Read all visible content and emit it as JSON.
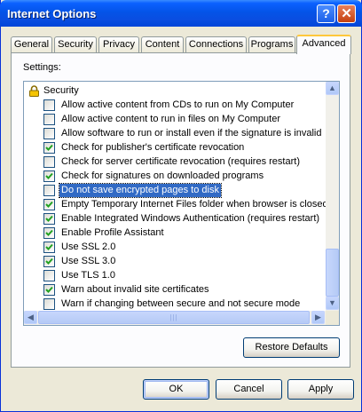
{
  "window": {
    "title": "Internet Options",
    "help_label": "?",
    "close_label": "✕"
  },
  "tabs": [
    "General",
    "Security",
    "Privacy",
    "Content",
    "Connections",
    "Programs",
    "Advanced"
  ],
  "active_tab": "Advanced",
  "settings_label": "Settings:",
  "settings": {
    "group": {
      "label": "Security",
      "icon": "lock-icon"
    },
    "items": [
      {
        "label": "Allow active content from CDs to run on My Computer",
        "checked": false
      },
      {
        "label": "Allow active content to run in files on My Computer",
        "checked": false
      },
      {
        "label": "Allow software to run or install even if the signature is invalid",
        "checked": false
      },
      {
        "label": "Check for publisher's certificate revocation",
        "checked": true
      },
      {
        "label": "Check for server certificate revocation (requires restart)",
        "checked": false
      },
      {
        "label": "Check for signatures on downloaded programs",
        "checked": true
      },
      {
        "label": "Do not save encrypted pages to disk",
        "checked": false,
        "selected": true
      },
      {
        "label": "Empty Temporary Internet Files folder when browser is closed",
        "checked": true
      },
      {
        "label": "Enable Integrated Windows Authentication (requires restart)",
        "checked": true
      },
      {
        "label": "Enable Profile Assistant",
        "checked": true
      },
      {
        "label": "Use SSL 2.0",
        "checked": true
      },
      {
        "label": "Use SSL 3.0",
        "checked": true
      },
      {
        "label": "Use TLS 1.0",
        "checked": false
      },
      {
        "label": "Warn about invalid site certificates",
        "checked": true
      },
      {
        "label": "Warn if changing between secure and not secure mode",
        "checked": false
      }
    ]
  },
  "restore_defaults_label": "Restore Defaults",
  "buttons": {
    "ok": "OK",
    "cancel": "Cancel",
    "apply": "Apply"
  },
  "colors": {
    "titlebar": "#0454e8",
    "selection": "#316ac5",
    "checkmark": "#21a121",
    "tab_highlight": "#ffc83c"
  }
}
